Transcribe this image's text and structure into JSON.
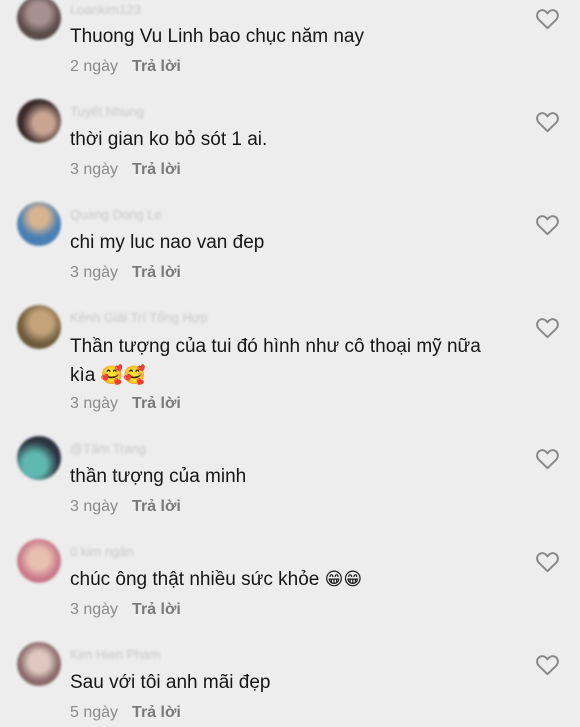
{
  "comments": [
    {
      "username": "Loankim123",
      "text": "Thuong Vu Linh bao chục năm nay",
      "text_emoji": "",
      "time": "2 ngày",
      "reply": "Trả lời",
      "avatar_colors": [
        "#5a4a4a",
        "#a89090"
      ]
    },
    {
      "username": "Tuyết Nhung",
      "text": "thời gian ko bỏ sót 1 ai.",
      "text_emoji": "",
      "time": "3 ngày",
      "reply": "Trả lời",
      "avatar_colors": [
        "#3a2a2a",
        "#c9a493"
      ]
    },
    {
      "username": "Quang Dong Le",
      "text": "chi my luc nao van đep",
      "text_emoji": "",
      "time": "3 ngày",
      "reply": "Trả lời",
      "avatar_colors": [
        "#4a7fb5",
        "#d7b48f"
      ]
    },
    {
      "username": "Kênh Giải Trí Tổng Hợp",
      "text": "Thần tượng của tui đó hình như cô thoại mỹ nữa kìa",
      "text_emoji": "🥰🥰",
      "time": "3 ngày",
      "reply": "Trả lời",
      "avatar_colors": [
        "#6b5a3a",
        "#c4a37a"
      ]
    },
    {
      "username": "@Tâm Trang",
      "text": "thần tượng của minh",
      "text_emoji": "",
      "time": "3 ngày",
      "reply": "Trả lời",
      "avatar_colors": [
        "#2e3540",
        "#5fb8b0"
      ]
    },
    {
      "username": "0 kim ngân",
      "text": "chúc ông thật nhiều sức khỏe",
      "text_emoji": "😁😁",
      "time": "3 ngày",
      "reply": "Trả lời",
      "avatar_colors": [
        "#c97a8a",
        "#e8c0b0"
      ]
    },
    {
      "username": "Kim Hien Pham",
      "text": "Sau với tôi anh mãi đẹp",
      "text_emoji": "",
      "time": "5 ngày",
      "reply": "Trả lời",
      "avatar_colors": [
        "#8a6a6a",
        "#e0c8c0"
      ]
    }
  ]
}
